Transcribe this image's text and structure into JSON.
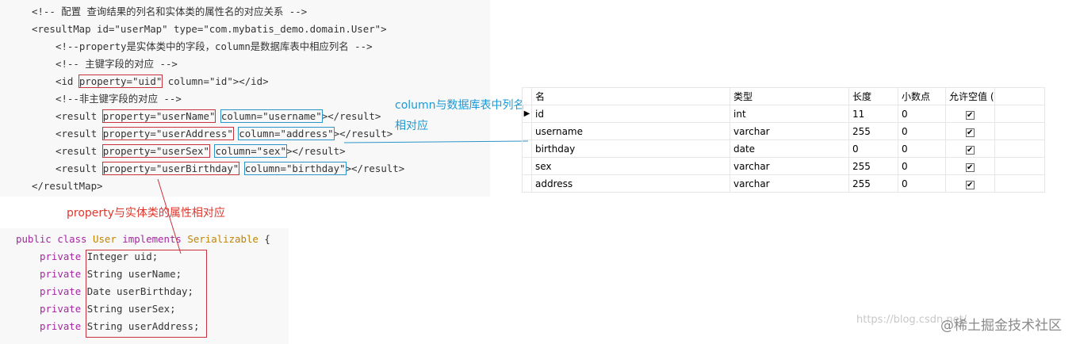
{
  "xml": {
    "comment_mapping": "<!-- 配置 查询结果的列名和实体类的属性名的对应关系 -->",
    "resultmap_open_prefix": "<resultMap id=\"userMap\" type=\"com.mybatis_demo.domain.User\">",
    "comment_property": "<!--property是实体类中的字段，column是数据库表中相应列名 -->",
    "comment_primary": "<!-- 主键字段的对应 -->",
    "id_prefix": "<id ",
    "id_property": "property=\"uid\"",
    "id_suffix": " column=\"id\"></id>",
    "comment_non_primary": "<!--非主键字段的对应 -->",
    "results": [
      {
        "prefix": "<result ",
        "property": "property=\"userName\"",
        "column": "column=\"username\"",
        "suffix": "></result>"
      },
      {
        "prefix": "<result ",
        "property": "property=\"userAddress\"",
        "column": "column=\"address\"",
        "suffix": "></result>"
      },
      {
        "prefix": "<result ",
        "property": "property=\"userSex\"",
        "column": "column=\"sex\"",
        "suffix": "></result>"
      },
      {
        "prefix": "<result ",
        "property": "property=\"userBirthday\"",
        "column": "column=\"birthday\"",
        "suffix": "></result>"
      }
    ],
    "resultmap_close": "</resultMap>"
  },
  "annotations": {
    "column_note": "column与数据库表中列名相对应",
    "property_note": "property与实体类的属性相对应"
  },
  "java": {
    "decl_public": "public class ",
    "decl_class": "User",
    "decl_implements": " implements ",
    "decl_iface": "Serializable",
    "decl_brace": " {",
    "private_kw": "private",
    "fields": [
      "Integer uid;",
      "String userName;",
      "Date userBirthday;",
      "String userSex;",
      "String userAddress;"
    ]
  },
  "db_table": {
    "headers": [
      "名",
      "类型",
      "长度",
      "小数点",
      "允许空值 ("
    ],
    "rows": [
      {
        "name": "id",
        "type": "int",
        "length": "11",
        "decimals": "0",
        "nullable": "✔"
      },
      {
        "name": "username",
        "type": "varchar",
        "length": "255",
        "decimals": "0",
        "nullable": "✔"
      },
      {
        "name": "birthday",
        "type": "date",
        "length": "0",
        "decimals": "0",
        "nullable": "✔"
      },
      {
        "name": "sex",
        "type": "varchar",
        "length": "255",
        "decimals": "0",
        "nullable": "✔"
      },
      {
        "name": "address",
        "type": "varchar",
        "length": "255",
        "decimals": "0",
        "nullable": "✔"
      }
    ],
    "current_row_marker": "▶"
  },
  "watermark": {
    "url": "https://blog.csdn.net/",
    "brand": "@稀土掘金技术社区"
  },
  "colors": {
    "annotation_red": "#e0352b",
    "annotation_blue": "#1a9ad6",
    "keyword_purple": "#a626a4",
    "class_gold": "#c18401"
  }
}
